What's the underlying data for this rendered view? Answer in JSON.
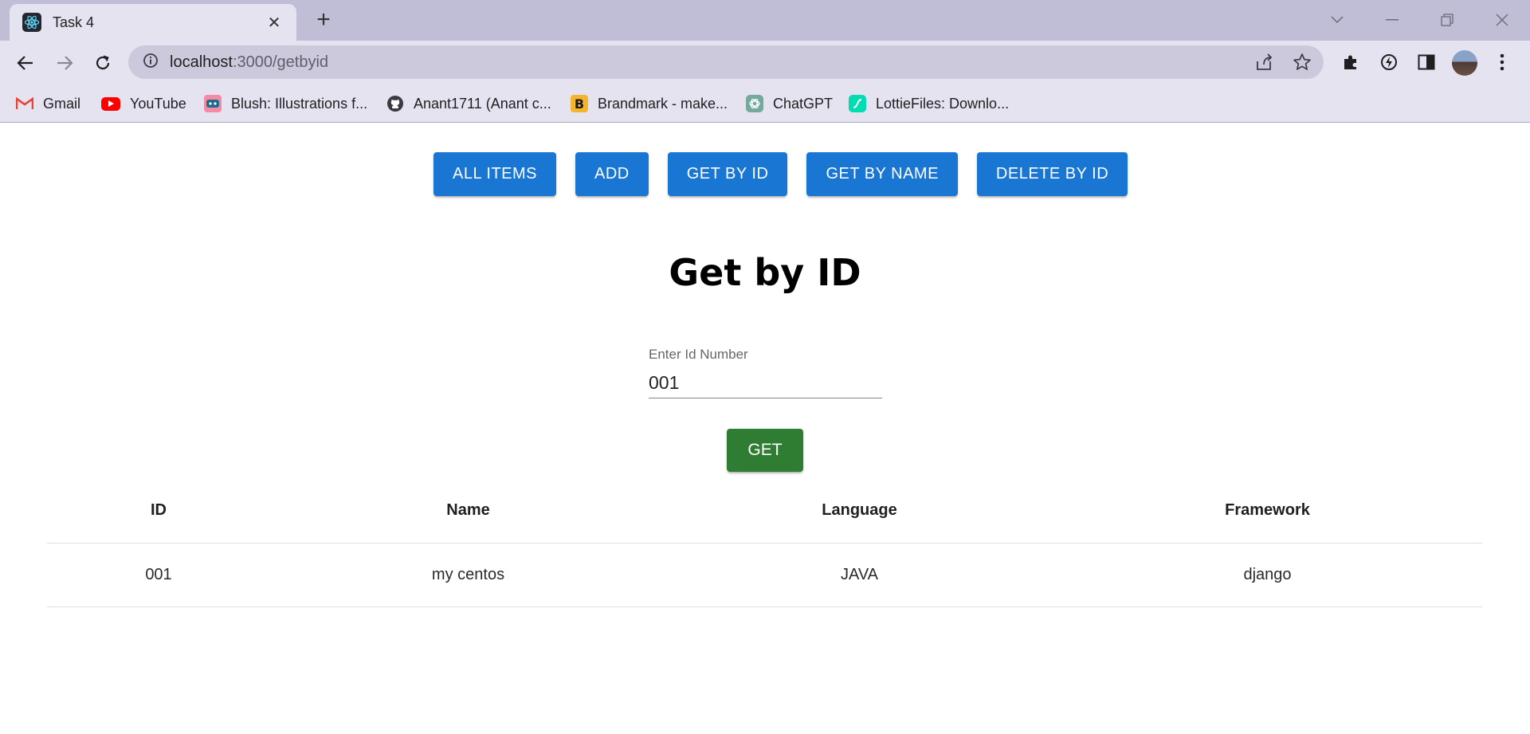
{
  "browser": {
    "tab_title": "Task 4",
    "tab_close": "✕",
    "new_tab": "+",
    "url_host": "localhost",
    "url_path": ":3000/getbyid",
    "bookmarks": [
      {
        "label": "Gmail",
        "icon": "gmail-icon"
      },
      {
        "label": "YouTube",
        "icon": "youtube-icon"
      },
      {
        "label": "Blush: Illustrations f...",
        "icon": "blush-icon"
      },
      {
        "label": "Anant1711 (Anant c...",
        "icon": "github-icon"
      },
      {
        "label": "Brandmark - make...",
        "icon": "brandmark-icon"
      },
      {
        "label": "ChatGPT",
        "icon": "chatgpt-icon"
      },
      {
        "label": "LottieFiles: Downlo...",
        "icon": "lottiefiles-icon"
      }
    ]
  },
  "nav": {
    "all_items": "ALL ITEMS",
    "add": "ADD",
    "get_by_id": "GET BY ID",
    "get_by_name": "GET BY NAME",
    "delete_by_id": "DELETE BY ID"
  },
  "page": {
    "heading": "Get by ID",
    "input_label": "Enter Id Number",
    "input_value": "001",
    "get_button": "GET"
  },
  "table": {
    "columns": [
      "ID",
      "Name",
      "Language",
      "Framework"
    ],
    "rows": [
      [
        "001",
        "my centos",
        "JAVA",
        "django"
      ]
    ]
  },
  "colors": {
    "primary": "#1976d2",
    "success": "#2e7d32",
    "chrome_frame": "#c0bdd6",
    "chrome_toolbar": "#e6e3f0"
  }
}
